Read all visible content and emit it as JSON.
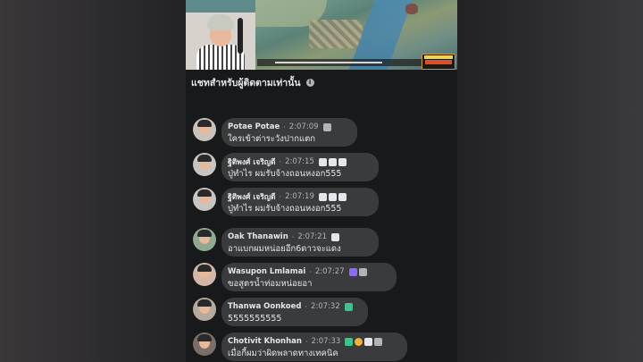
{
  "video": {
    "ticker_text": "",
    "logo_text": "FREE FIRE THAILAND"
  },
  "chat": {
    "header_title": "แชทสำหรับผู้ติดตามเท่านั้น",
    "info_icon": "i"
  },
  "messages": [
    {
      "name": "Potae Potae",
      "time": "2:07:09",
      "text": "ใครเข้าต่าระวังปากแตก",
      "badges": [
        "gray"
      ],
      "avatar_bg": "#c9c2b8"
    },
    {
      "name": "ฐิติพงศ์ เจริญดี",
      "time": "2:07:15",
      "text": "ปู่ทำไร ผมรับจ้างถอนหงอก555",
      "badges": [
        "white",
        "white",
        "white"
      ],
      "avatar_bg": "#c8c4bf"
    },
    {
      "name": "ฐิติพงศ์ เจริญดี",
      "time": "2:07:19",
      "text": "ปู่ทำไร ผมรับจ้างถอนหงอก555",
      "badges": [
        "white",
        "white",
        "white"
      ],
      "avatar_bg": "#c8c4bf"
    },
    {
      "name": "Oak Thanawin",
      "time": "2:07:21",
      "text": "อาแบกผมหน่อยอีก6ดาวจะแดง",
      "badges": [
        "white"
      ],
      "avatar_bg": "#8fa890"
    },
    {
      "name": "Wasupon Lmlamai",
      "time": "2:07:27",
      "text": "ขอสูตรน้ำท่อมหน่อยอา",
      "badges": [
        "purple",
        "gray"
      ],
      "avatar_bg": "#d3b6a6"
    },
    {
      "name": "Thanwa Oonkoed",
      "time": "2:07:32",
      "text": "5555555555",
      "badges": [
        "green"
      ],
      "avatar_bg": "#b5aa9e"
    },
    {
      "name": "Chotivit Khonhan",
      "time": "2:07:33",
      "text": "เมื่อกี้ผมว่าผิดพลาดทางเทคนิค",
      "badges": [
        "green",
        "gold",
        "white",
        "gray"
      ],
      "avatar_bg": "#7a6d6a"
    }
  ]
}
